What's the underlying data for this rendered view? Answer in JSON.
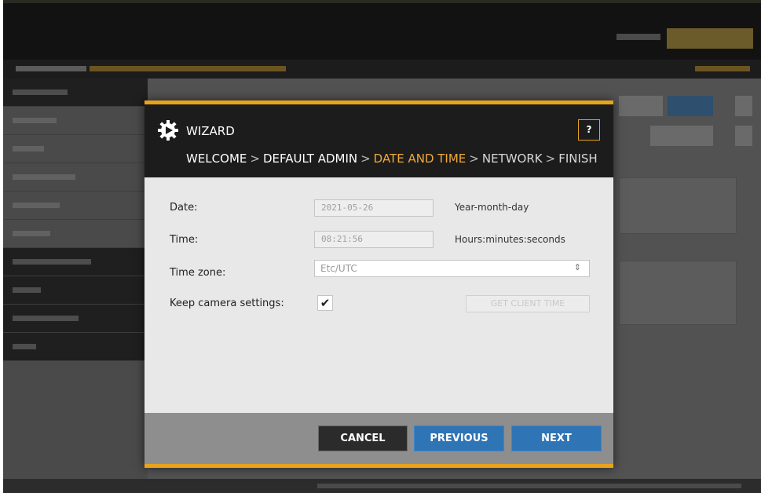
{
  "dialog": {
    "title": "WIZARD",
    "help_label": "?",
    "steps": {
      "welcome": "WELCOME",
      "default_admin": "DEFAULT ADMIN",
      "date_time": "DATE AND TIME",
      "network": "NETWORK",
      "finish": "FINISH",
      "separator": ">"
    },
    "fields": {
      "date_label": "Date:",
      "date_value": "2021-05-26",
      "date_hint": "Year-month-day",
      "time_label": "Time:",
      "time_value": "08:21:56",
      "time_hint": "Hours:minutes:seconds",
      "timezone_label": "Time zone:",
      "timezone_value": "Etc/UTC",
      "keep_label": "Keep camera settings:",
      "keep_checked": "✔",
      "client_time_button": "GET CLIENT TIME"
    },
    "buttons": {
      "cancel": "CANCEL",
      "previous": "PREVIOUS",
      "next": "NEXT"
    }
  },
  "colors": {
    "accent": "#e8a21e",
    "current_step": "#f0a93a",
    "primary_button": "#2f74b5",
    "header_bg": "#1c1c1c"
  },
  "icons": {
    "logo": "wizard-play-gear-icon",
    "checkbox": "checkmark-icon",
    "select": "select-updown-icon"
  }
}
